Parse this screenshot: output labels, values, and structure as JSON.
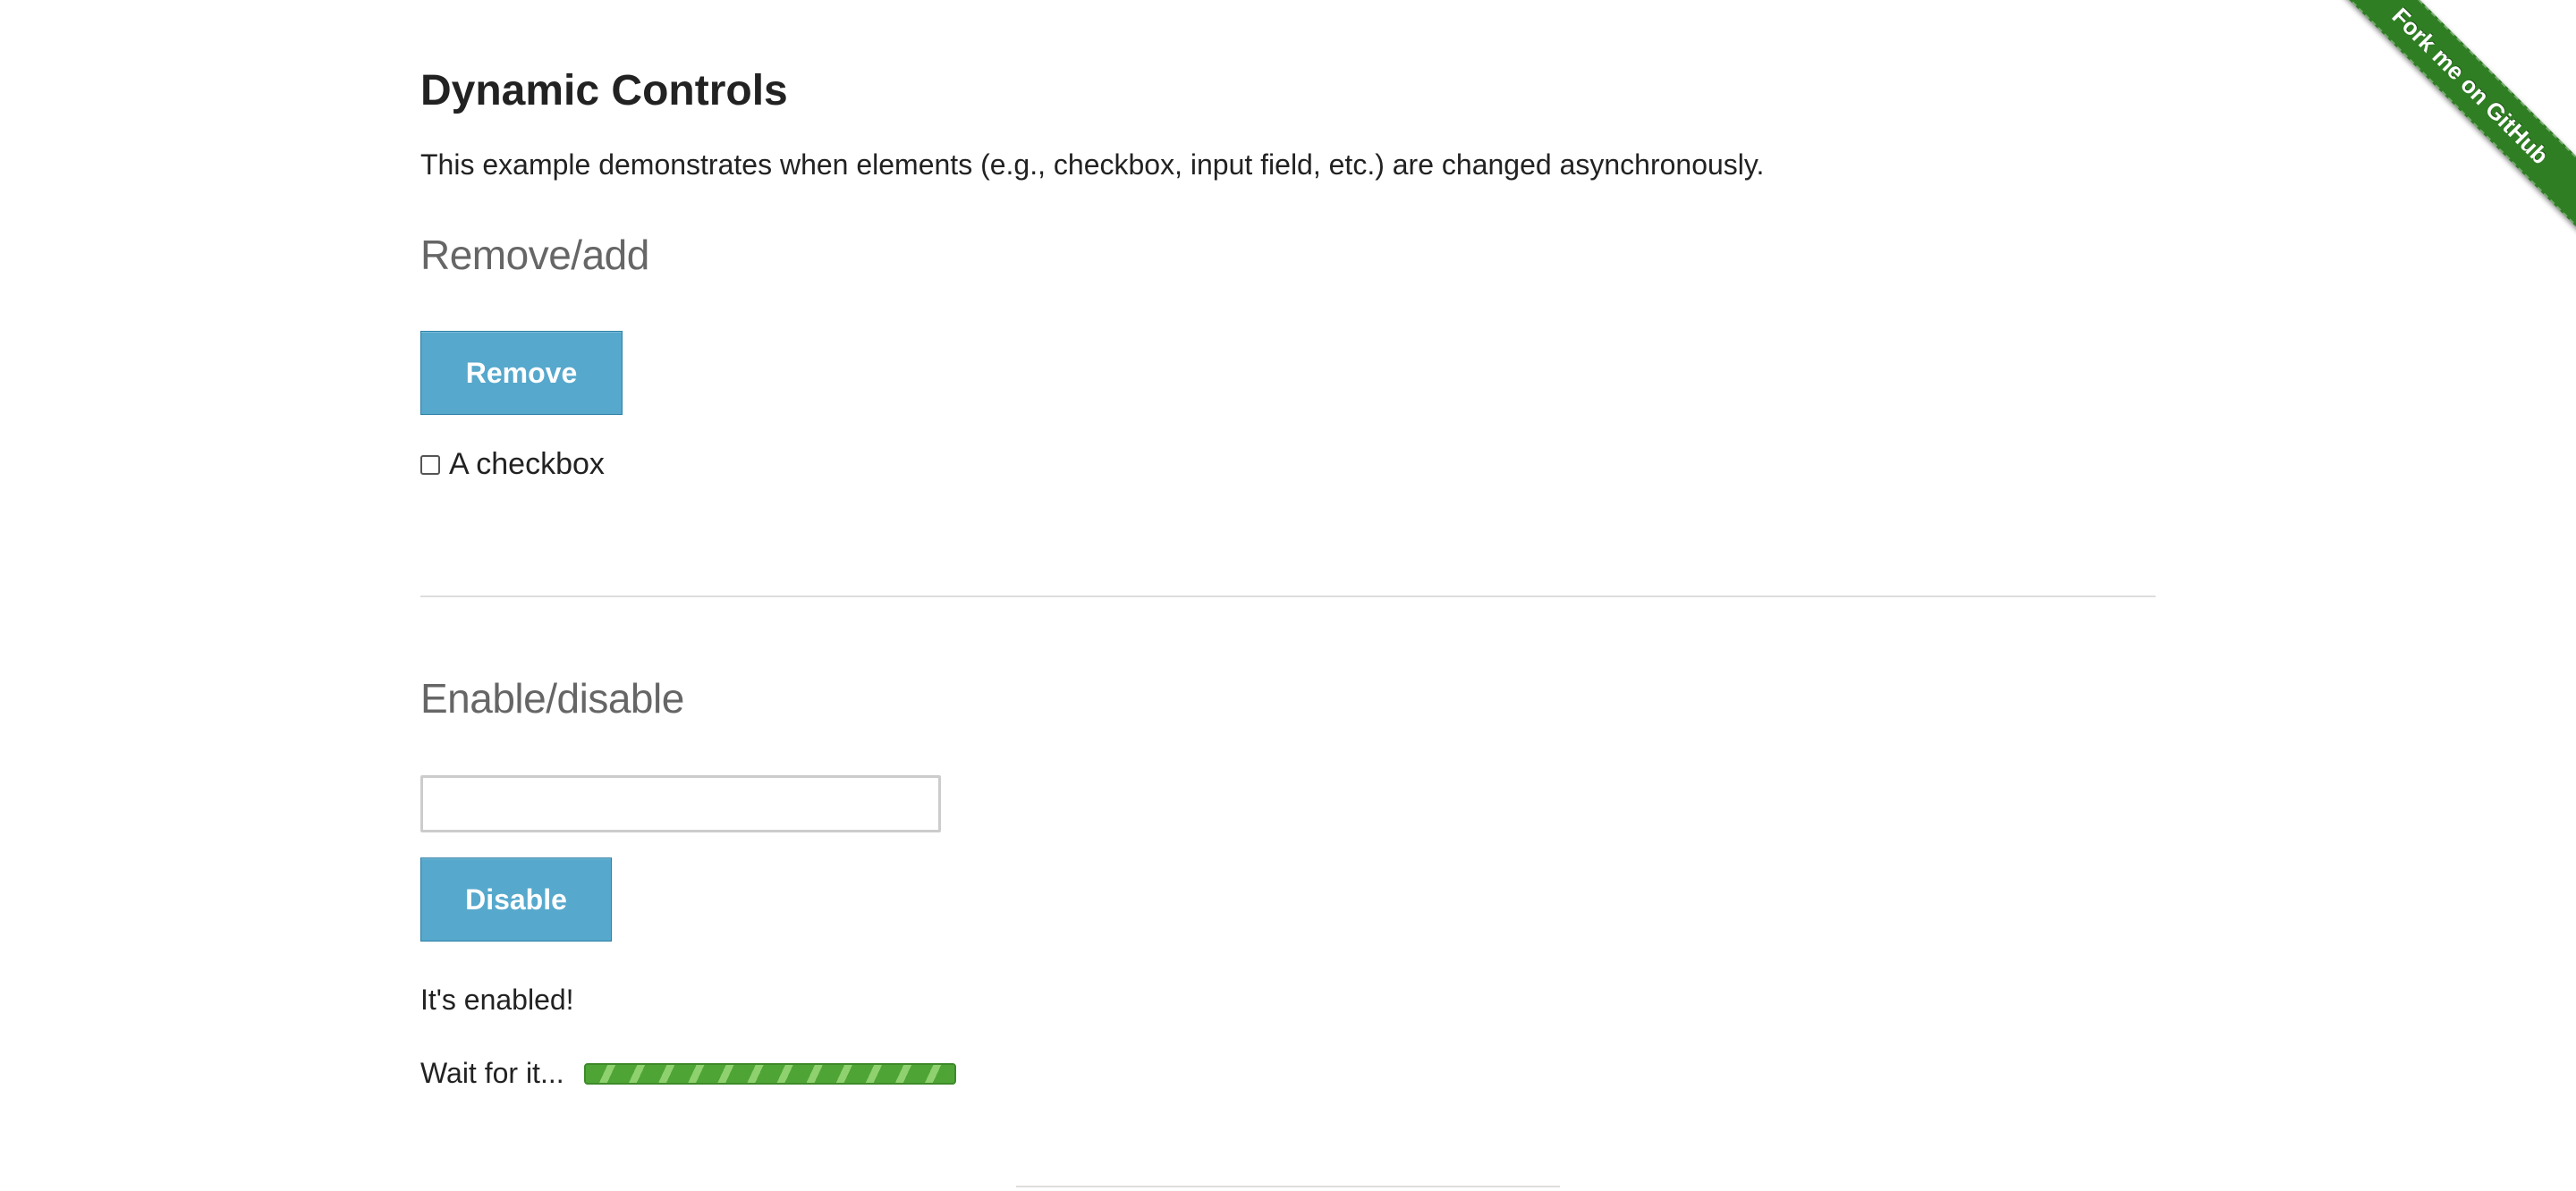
{
  "page": {
    "title": "Dynamic Controls",
    "description": "This example demonstrates when elements (e.g., checkbox, input field, etc.) are changed asynchronously."
  },
  "remove_add": {
    "heading": "Remove/add",
    "button_label": "Remove",
    "checkbox_label": "A checkbox",
    "checkbox_checked": false
  },
  "enable_disable": {
    "heading": "Enable/disable",
    "input_value": "",
    "button_label": "Disable",
    "status_message": "It's enabled!",
    "loading_text": "Wait for it...",
    "loading_progress_percent": 100
  },
  "ribbon": {
    "label": "Fork me on GitHub"
  },
  "colors": {
    "button_bg": "#56a8cc",
    "ribbon_bg": "#2f7e23",
    "progress_green": "#4ea535"
  },
  "icons": {
    "checkbox": "checkbox-icon",
    "progress": "progress-bar"
  }
}
